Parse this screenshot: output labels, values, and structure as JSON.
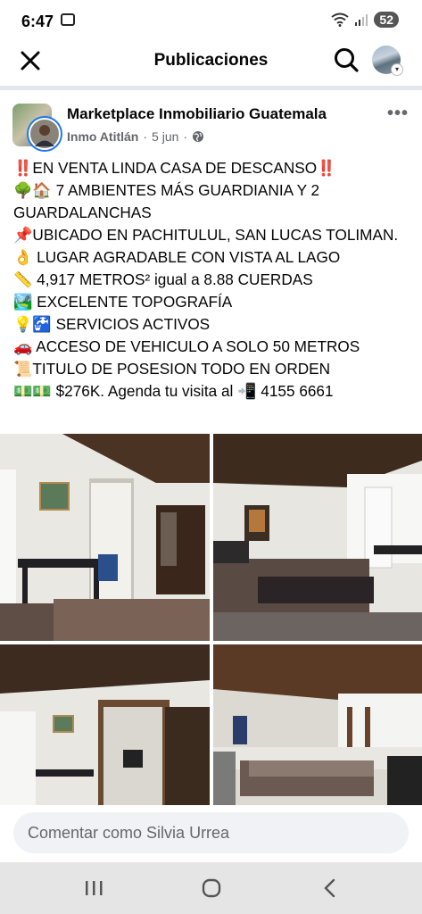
{
  "status_bar": {
    "time": "6:47",
    "battery": "52",
    "icons": [
      "screen-record-icon",
      "wifi-icon",
      "signal-icon",
      "battery-icon"
    ]
  },
  "header": {
    "title": "Publicaciones",
    "close_icon": "close-icon",
    "search_icon": "search-icon"
  },
  "post": {
    "group_name": "Marketplace Inmobiliario Guatemala",
    "author": "Inmo Atitlán",
    "separator": "·",
    "date": "5 jun",
    "privacy_icon": "globe-icon",
    "more_icon": "more-dots-icon",
    "lines": [
      {
        "emoji": "‼️",
        "text": "EN VENTA LINDA CASA DE DESCANSO",
        "emoji_end": "‼️"
      },
      {
        "emoji": "🌳🏠",
        "text": " 7 AMBIENTES MÁS GUARDIANIA Y 2 GUARDALANCHAS"
      },
      {
        "emoji": "📌",
        "text": "UBICADO EN PACHITULUL, SAN LUCAS TOLIMAN."
      },
      {
        "emoji": "👌",
        "text": " LUGAR AGRADABLE CON VISTA AL LAGO"
      },
      {
        "emoji": "📏",
        "text": " 4,917 METROS² igual a 8.88 CUERDAS"
      },
      {
        "emoji": "🏞️",
        "text": " EXCELENTE TOPOGRAFÍA"
      },
      {
        "emoji": "💡🚰",
        "text": " SERVICIOS ACTIVOS"
      },
      {
        "emoji": "🚗",
        "text": " ACCESO DE VEHICULO A SOLO 50 METROS"
      },
      {
        "emoji": "📜",
        "text": "TITULO DE POSESION TODO EN ORDEN"
      },
      {
        "emoji": "💵💵",
        "text": " $276K. Agenda tu visita al ",
        "emoji_end": "📲",
        "text_end": " 4155 6661"
      }
    ]
  },
  "comment": {
    "placeholder": "Comentar como Silvia Urrea"
  },
  "nav": {
    "icons": [
      "recent-apps-icon",
      "home-icon",
      "back-icon"
    ]
  }
}
